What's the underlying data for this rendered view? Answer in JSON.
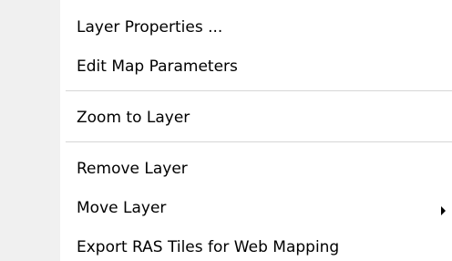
{
  "menu": {
    "items": [
      {
        "label": "Layer Properties ...",
        "has_submenu": false
      },
      {
        "label": "Edit Map Parameters",
        "has_submenu": false
      },
      {
        "label": "Zoom to Layer",
        "has_submenu": false
      },
      {
        "label": "Remove Layer",
        "has_submenu": false
      },
      {
        "label": "Move Layer",
        "has_submenu": true,
        "submenu_indicator": "chevron-right-icon"
      },
      {
        "label": "Export RAS Tiles for Web Mapping",
        "has_submenu": false
      }
    ]
  },
  "colors": {
    "gutter": "#f0f0f0",
    "background": "#ffffff",
    "separator": "#d6d6d6",
    "text": "#000000"
  }
}
